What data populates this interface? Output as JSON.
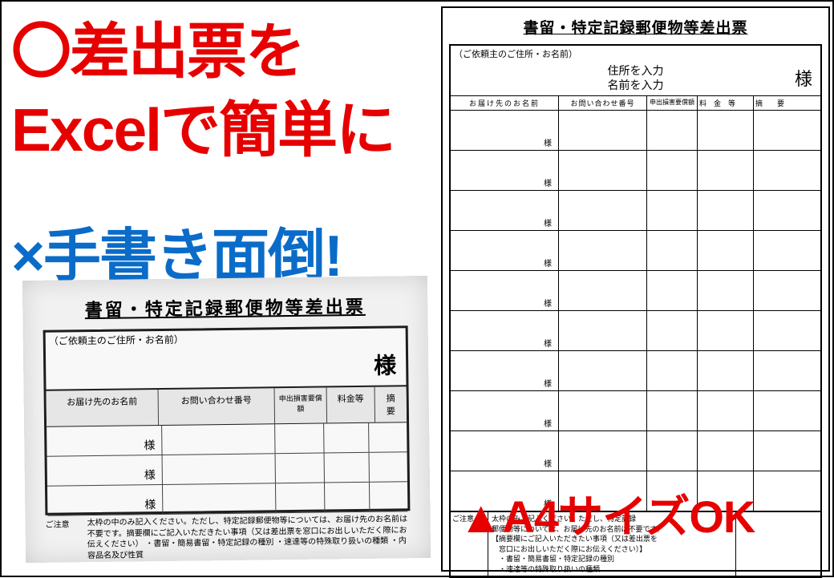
{
  "headlines": {
    "red_line1": "〇差出票を",
    "red_line2": "Excelで簡単に",
    "blue": "×手書き面倒!",
    "a4ok": "▲A4サイズOK"
  },
  "form": {
    "title": "書留・特定記録郵便物等差出票",
    "sender_label": "（ご依頼主のご住所・お名前）",
    "sama": "様",
    "new_address_placeholder": "住所を入力",
    "new_name_placeholder": "名前を入力",
    "columns": {
      "c1": "お届け先のお名前",
      "c2": "お問い合わせ番号",
      "c3": "申出損害要償額",
      "c4_full": "料　金　等",
      "c4_short": "料金等",
      "c5": "摘　　要"
    },
    "row_suffix": "様",
    "notes_label": "ご注意",
    "notes_old": "太枠の中のみ記入ください。ただし、特定記録郵便物等については、お届け先のお名前は不要です。摘要欄にご記入いただきたい事項（又は差出票を窓口にお出しいただく際にお伝えください）\n・書留・簡易書留・特定記録の種別\n・速達等の特殊取り扱いの種類\n・内容品名及び性質",
    "notes_new_lines": [
      "太枠のみご記入ください。ただし、特定記録",
      "郵便物等については、お届け先のお名前は不要です。",
      "【摘要欄にご記入いただきたい事項（又は差出票を",
      "　窓口にお出しいただく際にお伝えください）】",
      "　・書留・簡易書留・特定記録の種別",
      "　・速達等の特殊取り扱いの種類"
    ]
  }
}
